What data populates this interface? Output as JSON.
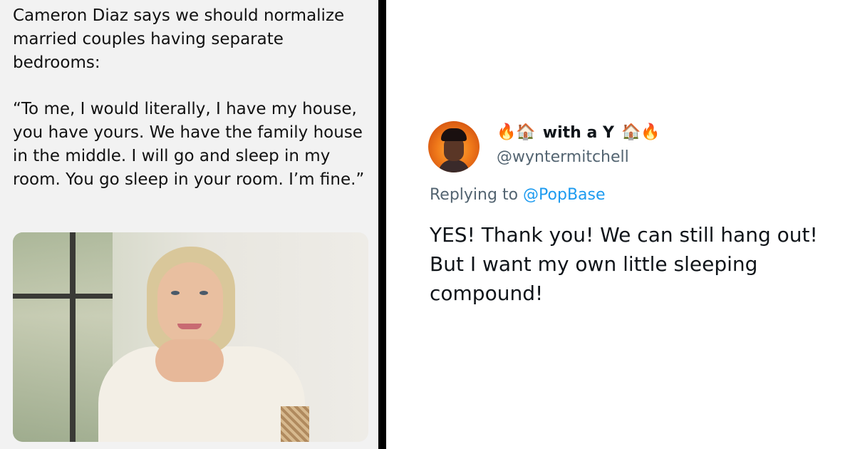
{
  "left_post": {
    "intro": "Cameron Diaz says we should normalize married couples having separate bedrooms:",
    "quote": "“To me, I would literally, I have my house, you have yours. We have the family house in the middle. I will go and sleep in my room. You go sleep in your room. I’m fine.”"
  },
  "reply_tweet": {
    "display_name_prefix": "🔥🏠",
    "display_name": "with a Y",
    "display_name_suffix": "🏠🔥",
    "handle": "@wyntermitchell",
    "replying_label": "Replying to",
    "replying_mention": "@PopBase",
    "text": "YES! Thank you! We can still hang out! But I want my own little sleeping compound!"
  },
  "colors": {
    "left_bg": "#f2f2f2",
    "divider": "#000000",
    "mention": "#1d9bf0",
    "secondary_text": "#536471",
    "primary_text": "#0f1419"
  },
  "icons": [
    "fire-emoji",
    "house-emoji",
    "avatar-image",
    "photo-image"
  ]
}
